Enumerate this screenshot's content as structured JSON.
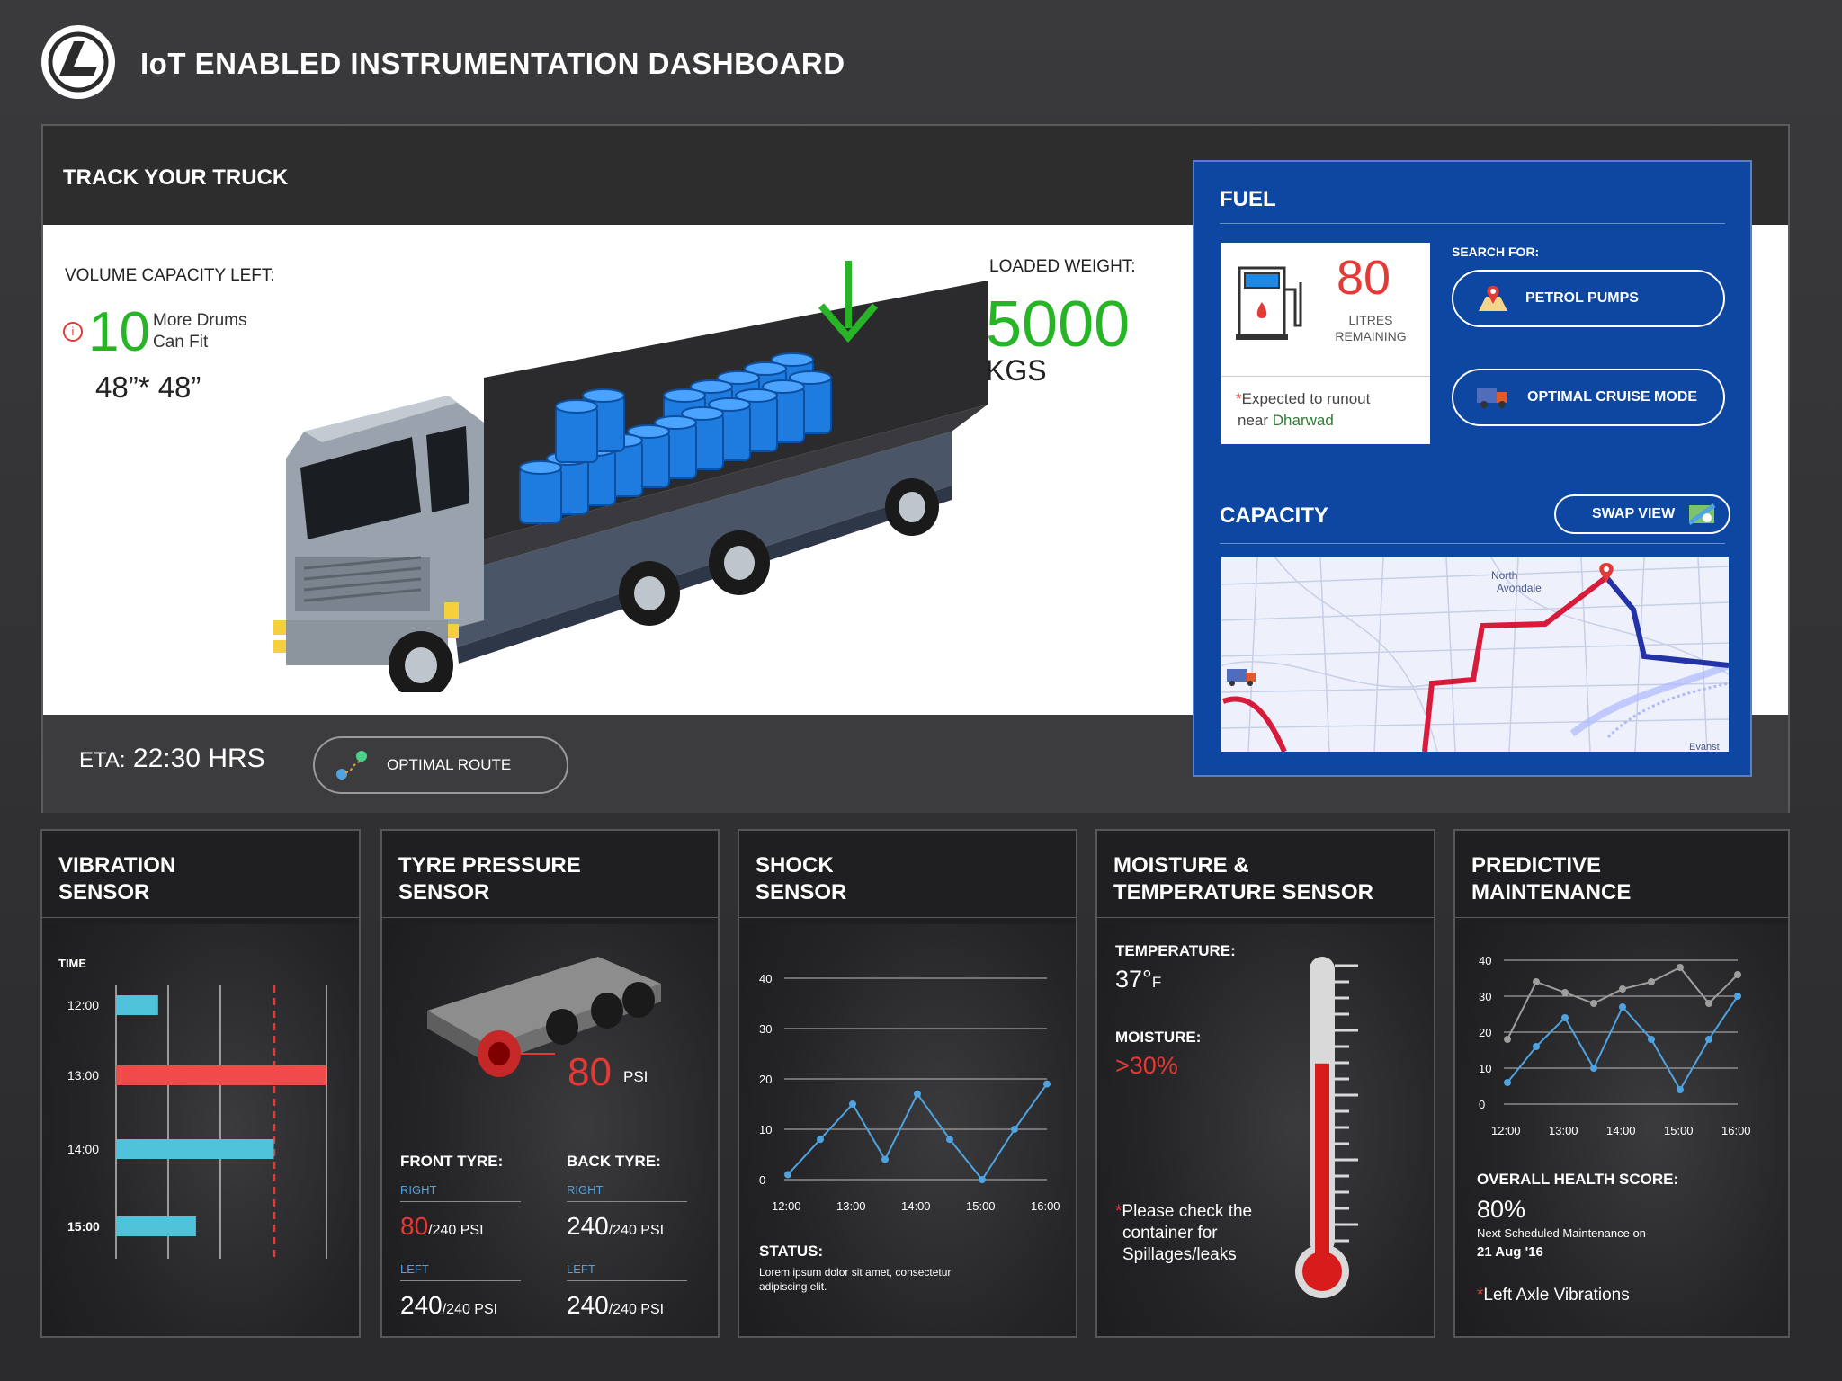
{
  "header": {
    "title": "IoT ENABLED INSTRUMENTATION DASHBOARD"
  },
  "track": {
    "title": "TRACK YOUR TRUCK",
    "volume_label": "VOLUME CAPACITY LEFT:",
    "drums_count": "10",
    "drums_text_1": "More Drums",
    "drums_text_2": "Can Fit",
    "drum_size": "48”* 48”",
    "loaded_weight_label": "LOADED WEIGHT:",
    "loaded_weight_value": "5000",
    "loaded_weight_unit": "KGS",
    "eta_label": "ETA:",
    "eta_value": "22:30 HRS",
    "optimal_route_label": "OPTIMAL ROUTE"
  },
  "fuel": {
    "title": "FUEL",
    "litres": "80",
    "litres_label_1": "LITRES",
    "litres_label_2": "REMAINING",
    "runout_1": "Expected to runout",
    "runout_2": "near",
    "runout_city": "Dharwad",
    "search_label": "SEARCH FOR:",
    "petrol_pumps_label": "PETROL PUMPS",
    "cruise_label": "OPTIMAL CRUISE MODE",
    "capacity_title": "CAPACITY",
    "swap_view_label": "SWAP VIEW",
    "map_labels": {
      "north_avondale_1": "North",
      "north_avondale_2": "Avondale",
      "corner": "Evanst"
    }
  },
  "vibration": {
    "title_1": "VIBRATION",
    "title_2": "SENSOR",
    "time_label": "TIME",
    "rows": [
      {
        "time": "12:00",
        "value": 0.2,
        "color": "#4fc3d9"
      },
      {
        "time": "13:00",
        "value": 1.0,
        "color": "#f04a4a"
      },
      {
        "time": "14:00",
        "value": 0.75,
        "color": "#4fc3d9"
      },
      {
        "time": "15:00",
        "value": 0.38,
        "color": "#4fc3d9"
      }
    ]
  },
  "tyre": {
    "title_1": "TYRE PRESSURE",
    "title_2": "SENSOR",
    "psi_value": "80",
    "psi_unit": "PSI",
    "front_label": "FRONT TYRE:",
    "back_label": "BACK TYRE:",
    "right_label": "RIGHT",
    "left_label": "LEFT",
    "front_right": "80",
    "front_left": "240",
    "back_right": "240",
    "back_left": "240",
    "max": "/240 PSI"
  },
  "shock": {
    "title_1": "SHOCK",
    "title_2": "SENSOR",
    "status_label": "STATUS:",
    "status_text_1": "Lorem ipsum dolor sit amet, consectetur",
    "status_text_2": "adipiscing elit."
  },
  "moisture": {
    "title_1": "MOISTURE &",
    "title_2": "TEMPERATURE SENSOR",
    "temp_label": "TEMPERATURE:",
    "temp_value": "37°",
    "temp_unit": "F",
    "moisture_label": "MOISTURE:",
    "moisture_value": ">30%",
    "note_1": "Please check the",
    "note_2": "container for",
    "note_3": "Spillages/leaks",
    "thermometer_level": 0.68
  },
  "maintenance": {
    "title_1": "PREDICTIVE",
    "title_2": "MAINTENANCE",
    "health_label": "OVERALL HEALTH SCORE:",
    "health_value": "80%",
    "next_label": "Next Scheduled Maintenance on",
    "next_date": "21 Aug '16",
    "alert": "Left Axle Vibrations"
  },
  "chart_data": [
    {
      "type": "line",
      "x": [
        "12:00",
        "12:30",
        "13:00",
        "13:30",
        "14:00",
        "14:30",
        "15:00",
        "15:30",
        "16:00"
      ],
      "x_ticks": [
        "12:00",
        "13:00",
        "14:00",
        "15:00",
        "16:00"
      ],
      "series": [
        {
          "values": [
            1,
            8,
            15,
            4,
            17,
            8,
            0,
            10,
            19
          ]
        }
      ],
      "ylim": [
        0,
        40
      ],
      "y_ticks": [
        "0",
        "10",
        "20",
        "30",
        "40"
      ],
      "color": "#4fa3e0",
      "grid": true
    },
    {
      "type": "line",
      "x": [
        "12:00",
        "12:30",
        "13:00",
        "13:30",
        "14:00",
        "14:30",
        "15:00",
        "15:30",
        "16:00"
      ],
      "x_ticks": [
        "12:00",
        "13:00",
        "14:00",
        "15:00",
        "16:00"
      ],
      "series": [
        {
          "values": [
            6,
            16,
            24,
            10,
            27,
            18,
            4,
            18,
            30
          ],
          "color": "#4fa3e0"
        },
        {
          "values": [
            18,
            34,
            31,
            28,
            32,
            34,
            38,
            28,
            36
          ],
          "color": "#9e9e9e"
        }
      ],
      "ylim": [
        0,
        40
      ],
      "y_ticks": [
        "0",
        "10",
        "20",
        "30",
        "40"
      ],
      "grid": true
    }
  ]
}
